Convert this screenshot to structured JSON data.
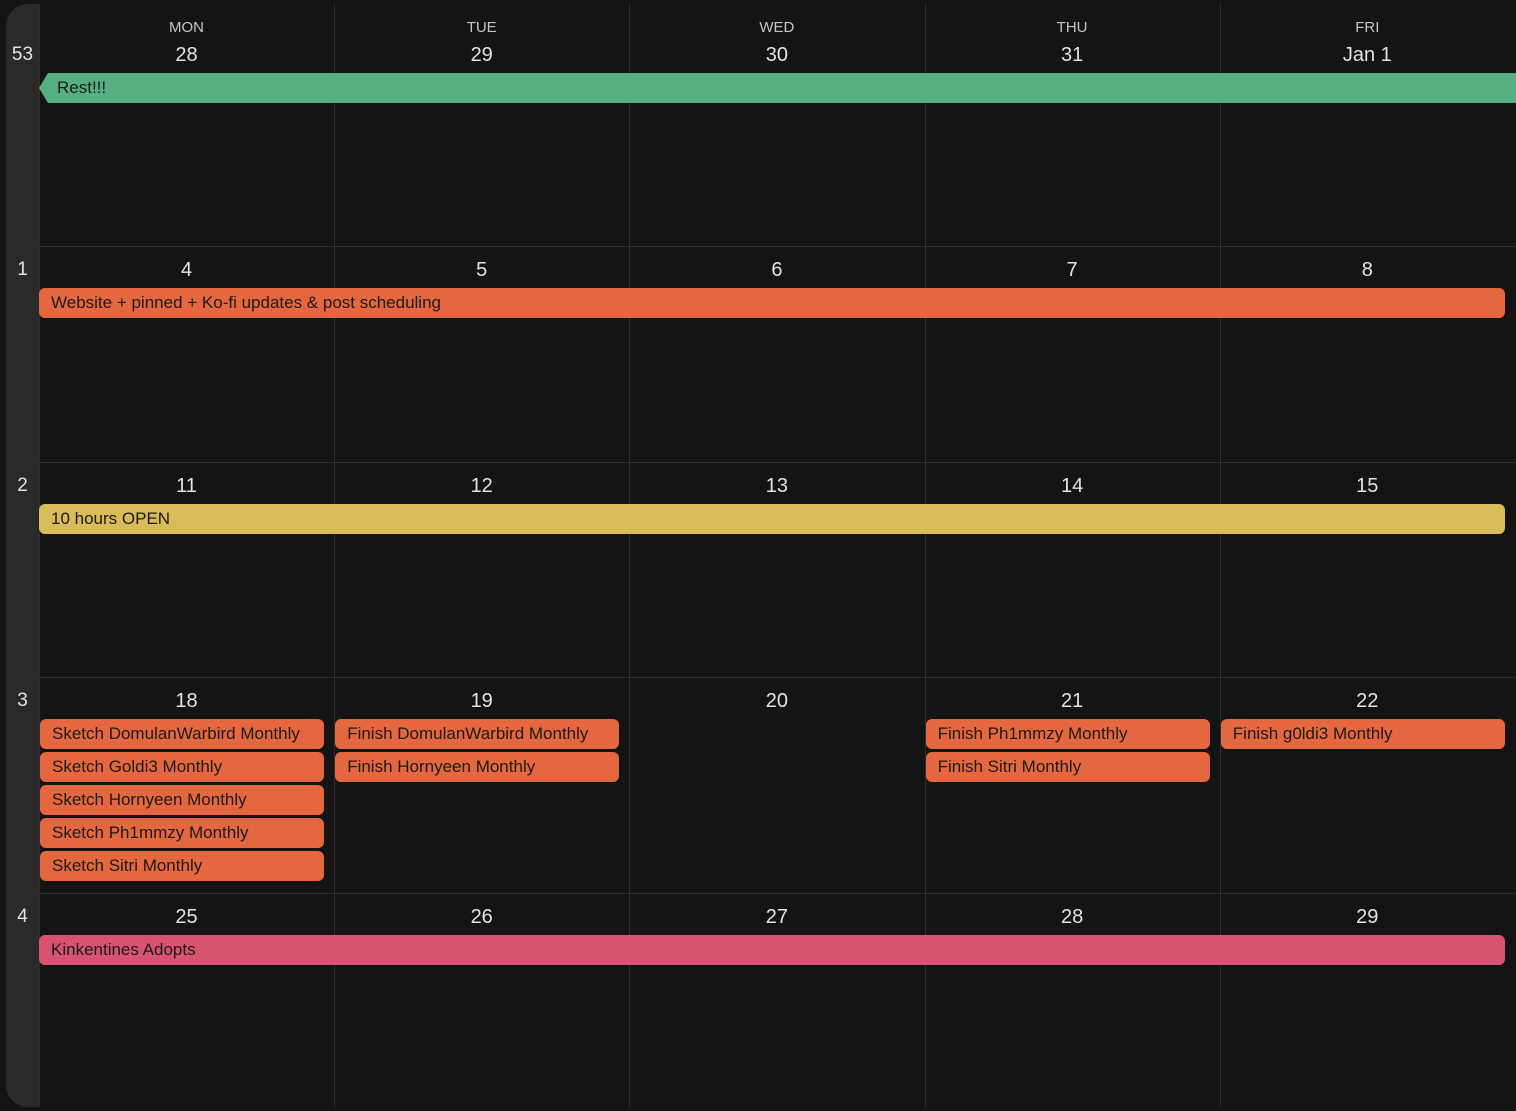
{
  "calendar": {
    "day_headers": [
      "MON",
      "TUE",
      "WED",
      "THU",
      "FRI"
    ],
    "weeks": [
      {
        "week_number": "53",
        "days": [
          "28",
          "29",
          "30",
          "31",
          "Jan 1"
        ],
        "bars": [
          {
            "label": "Rest!!!",
            "color": "#57b082",
            "continues_from_previous": true
          }
        ]
      },
      {
        "week_number": "1",
        "days": [
          "4",
          "5",
          "6",
          "7",
          "8"
        ],
        "bars": [
          {
            "label": "Website + pinned + Ko-fi updates & post scheduling",
            "color": "#e5673f"
          }
        ]
      },
      {
        "week_number": "2",
        "days": [
          "11",
          "12",
          "13",
          "14",
          "15"
        ],
        "bars": [
          {
            "label": "10 hours OPEN",
            "color": "#d9bb5a"
          }
        ]
      },
      {
        "week_number": "3",
        "days": [
          "18",
          "19",
          "20",
          "21",
          "22"
        ],
        "day_events": [
          [
            "Sketch DomulanWarbird Monthly",
            "Sketch Goldi3 Monthly",
            "Sketch Hornyeen Monthly",
            "Sketch Ph1mmzy Monthly",
            "Sketch Sitri Monthly"
          ],
          [
            "Finish DomulanWarbird Monthly",
            "Finish Hornyeen Monthly"
          ],
          [],
          [
            "Finish Ph1mmzy Monthly",
            "Finish Sitri Monthly"
          ],
          [
            "Finish g0ldi3 Monthly"
          ]
        ],
        "event_color": "#e5673f"
      },
      {
        "week_number": "4",
        "days": [
          "25",
          "26",
          "27",
          "28",
          "29"
        ],
        "bars": [
          {
            "label": "Kinkentines Adopts",
            "color": "#d8536f"
          }
        ]
      }
    ]
  },
  "colors": {
    "background": "#141414",
    "gridline": "#2e2e2e",
    "week_strip": "#2a2a2a",
    "text": "#e3e3e3"
  }
}
